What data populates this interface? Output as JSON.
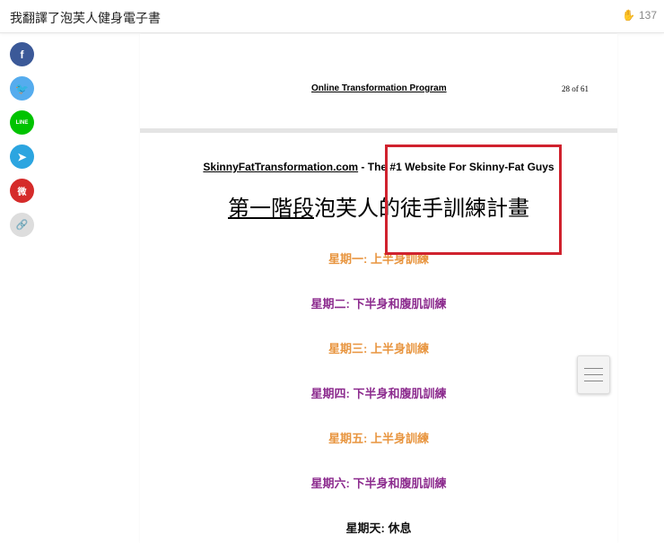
{
  "header": {
    "title": "我翻譯了泡芙人健身電子書",
    "clap_count": "137"
  },
  "share": [
    {
      "name": "facebook",
      "glyph": "f",
      "color": "#3b5998"
    },
    {
      "name": "twitter",
      "glyph": "🐦",
      "color": "#55acee"
    },
    {
      "name": "line",
      "glyph": "LINE",
      "color": "#00c300"
    },
    {
      "name": "telegram",
      "glyph": "➤",
      "color": "#2ca5e0"
    },
    {
      "name": "weibo",
      "glyph": "微",
      "color": "#d52b2a"
    },
    {
      "name": "copy-link",
      "glyph": "🔗",
      "color": "#ddd"
    }
  ],
  "document": {
    "running_header": "Online Transformation Program",
    "page_number": "28 of 61",
    "site": "SkinnyFatTransformation.com",
    "tagline": " - The #1 Website For Skinny-Fat Guys",
    "title_underlined": "第一階段",
    "title_rest": "泡芙人的徒手訓練計畫",
    "days": [
      {
        "label": "星期一: 上半身訓練",
        "color": "orange"
      },
      {
        "label": "星期二: 下半身和腹肌訓練",
        "color": "purple"
      },
      {
        "label": "星期三: 上半身訓練",
        "color": "orange"
      },
      {
        "label": "星期四: 下半身和腹肌訓練",
        "color": "purple"
      },
      {
        "label": "星期五: 上半身訓練",
        "color": "orange"
      },
      {
        "label": "星期六: 下半身和腹肌訓練",
        "color": "purple"
      },
      {
        "label": "星期天: 休息",
        "color": "black"
      }
    ]
  },
  "colors": {
    "orange": "#e8953f",
    "purple": "#8c2b8e",
    "highlight": "#d0222e"
  }
}
